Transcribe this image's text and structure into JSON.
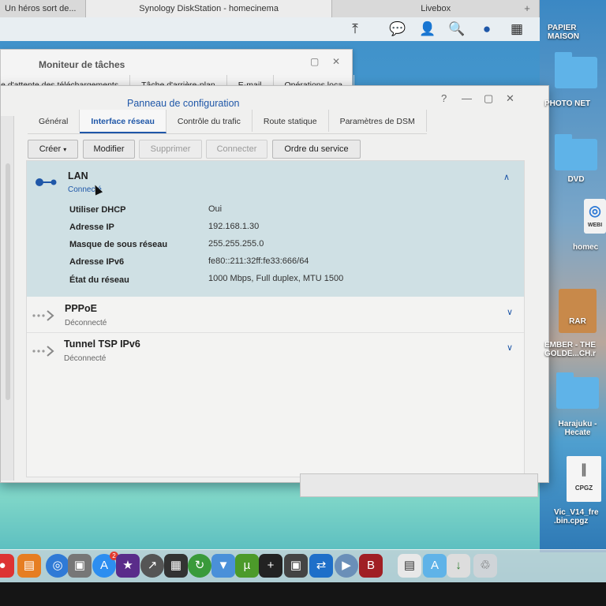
{
  "browser": {
    "tabs": [
      "Un héros sort de...",
      "Synology DiskStation - homecinema",
      "Livebox"
    ]
  },
  "task_monitor": {
    "title": "Moniteur de tâches",
    "tabs": [
      "e d'attente des téléchargements",
      "Tâche d'arrière-plan",
      "E-mail",
      "Opérations loca"
    ]
  },
  "config": {
    "title": "Panneau de configuration",
    "tabs": [
      "Général",
      "Interface réseau",
      "Contrôle du trafic",
      "Route statique",
      "Paramètres de DSM"
    ],
    "active_tab": "Interface réseau",
    "toolbar": {
      "create": "Créer",
      "modify": "Modifier",
      "delete": "Supprimer",
      "connect": "Connecter",
      "service_order": "Ordre du service"
    },
    "interfaces": [
      {
        "name": "LAN",
        "status": "Connecté",
        "details": [
          {
            "label": "Utiliser DHCP",
            "value": "Oui"
          },
          {
            "label": "Adresse IP",
            "value": "192.168.1.30"
          },
          {
            "label": "Masque de sous réseau",
            "value": "255.255.255.0"
          },
          {
            "label": "Adresse IPv6",
            "value": "fe80::211:32ff:fe33:666/64"
          },
          {
            "label": "État du réseau",
            "value": "1000 Mbps, Full duplex, MTU 1500"
          }
        ]
      },
      {
        "name": "PPPoE",
        "status": "Déconnecté"
      },
      {
        "name": "Tunnel TSP IPv6",
        "status": "Déconnecté"
      }
    ]
  },
  "desktop": {
    "icons": [
      {
        "label": "PAPIER MAISON"
      },
      {
        "label": "PHOTO NET"
      },
      {
        "label": "DVD"
      },
      {
        "label": "WEBI"
      },
      {
        "label": "homec"
      },
      {
        "label": "RAR"
      },
      {
        "label": "EMBER - THE GOLDE...CH.r"
      },
      {
        "label": "Harajuku - Hecate"
      },
      {
        "label": "CPGZ"
      },
      {
        "label": "Vic_V14_fre .bin.cpgz"
      }
    ]
  },
  "dock": {
    "app_store_badge": "2"
  },
  "colors": {
    "accent": "#1f57a8",
    "expanded_row": "#cfe0e4",
    "desktop": "#4aa3d6"
  }
}
